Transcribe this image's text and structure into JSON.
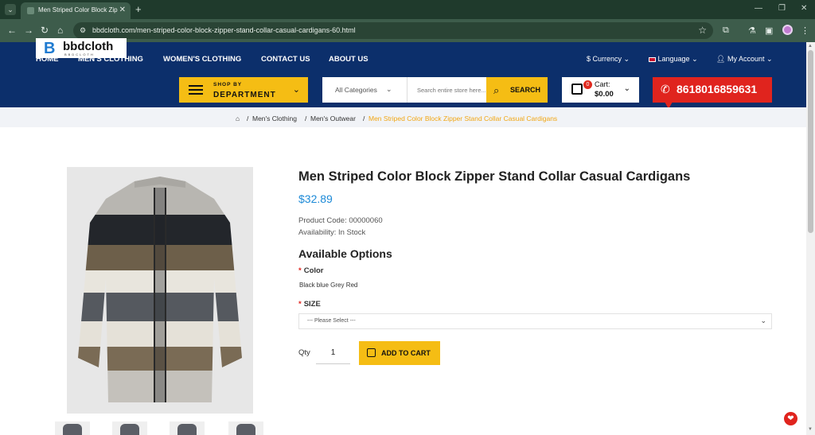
{
  "browser": {
    "tab_title": "Men Striped Color Block Zipp…",
    "url": "bbdcloth.com/men-striped-color-block-zipper-stand-collar-casual-cardigans-60.html"
  },
  "topnav": {
    "items": [
      "HOME",
      "MEN'S CLOTHING",
      "WOMEN'S CLOTHING",
      "CONTACT US",
      "ABOUT US"
    ],
    "currency": "$ Currency",
    "language": "Language",
    "account": "My Account"
  },
  "logo": {
    "name": "bbdcloth",
    "sub": "BBDCLOTH"
  },
  "department": {
    "small": "SHOP BY",
    "big": "DEPARTMENT"
  },
  "search": {
    "category": "All Categories",
    "placeholder": "Search entire store here...",
    "button": "SEARCH"
  },
  "cart": {
    "count": "0",
    "label": "Cart:",
    "total": "$0.00"
  },
  "phone": "8618016859631",
  "breadcrumb": {
    "items": [
      "Men's Clothing",
      "Men's Outwear"
    ],
    "current": "Men Striped Color Block Zipper Stand Collar Casual Cardigans"
  },
  "product": {
    "title": "Men Striped Color Block Zipper Stand Collar Casual Cardigans",
    "price": "$32.89",
    "code": "Product Code: 00000060",
    "availability": "Availability: In Stock",
    "options_heading": "Available Options",
    "color_label": "Color",
    "colors": "Black blue Grey Red",
    "size_label": "SIZE",
    "size_placeholder": "--- Please Select ---",
    "qty_label": "Qty",
    "qty_value": "1",
    "add_to_cart": "ADD TO CART"
  },
  "colors": {
    "navy": "#0c2f6b",
    "accent_yellow": "#f5bd14",
    "accent_red": "#e0241e",
    "price_blue": "#1d8ad7",
    "breadcrumb_current": "#f1a613"
  }
}
